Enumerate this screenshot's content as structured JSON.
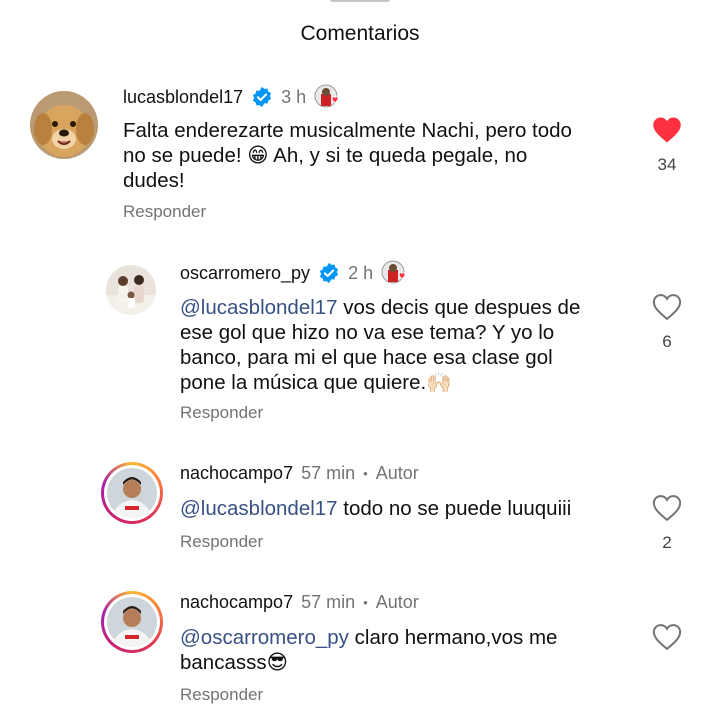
{
  "header": {
    "title": "Comentarios"
  },
  "comments": [
    {
      "username": "lucasblondel17",
      "time": "3 h",
      "text": "Falta enderezarte musicalmente Nachi, pero todo no se puede! 😁 Ah, y si te queda pegale, no dudes!",
      "line1": "Falta enderezarte musicalmente Nachi, pero todo",
      "line2": "no se puede! 😁 Ah, y si te queda pegale, no",
      "line3": "dudes!",
      "reply": "Responder",
      "likes": "34",
      "liked": true
    },
    {
      "username": "oscarromero_py",
      "time": "2 h",
      "mention": "@lucasblondel17",
      "line1": " vos decis que despues de",
      "line2": "ese gol que hizo no va ese tema? Y yo lo",
      "line3": "banco, para mi el que hace esa clase gol",
      "line4": "pone la música que quiere.🙌🏻",
      "reply": "Responder",
      "likes": "6",
      "liked": false
    },
    {
      "username": "nachocampo7",
      "time": "57 min",
      "author_badge": "Autor",
      "mention": "@lucasblondel17",
      "line1": " todo no se puede luuquiii",
      "reply": "Responder",
      "likes": "2",
      "liked": false
    },
    {
      "username": "nachocampo7",
      "time": "57 min",
      "author_badge": "Autor",
      "mention": "@oscarromero_py",
      "line1": " claro hermano,vos me",
      "line2": "bancasss😎",
      "reply": "Responder",
      "liked": false
    }
  ],
  "colors": {
    "like_red": "#ff3040",
    "verified_blue": "#0095f6",
    "mention": "#385185",
    "muted": "#737373"
  }
}
